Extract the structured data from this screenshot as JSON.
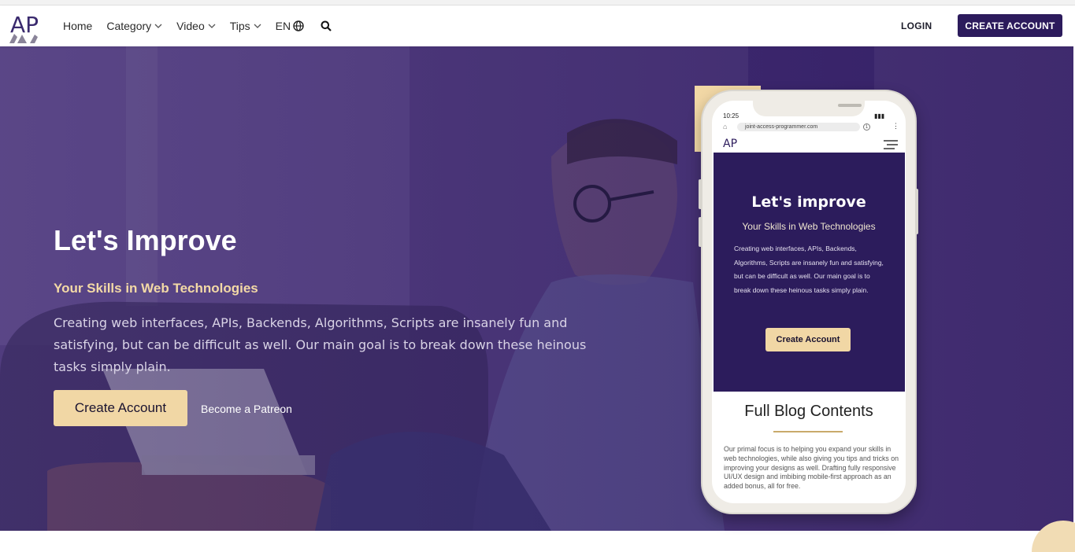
{
  "nav": {
    "logo_text": "AP",
    "links": [
      "Home",
      "Category",
      "Video",
      "Tips",
      "EN"
    ],
    "login": "LOGIN",
    "create_account": "CREATE ACCOUNT"
  },
  "hero": {
    "title": "Let's Improve",
    "subtitle": "Your Skills in Web Technologies",
    "text": "Creating web interfaces, APIs, Backends, Algorithms, Scripts are insanely fun and satisfying, but can be difficult as well. Our main goal is to break down these heinous tasks simply plain.",
    "button": "Create Account",
    "patreon": "Become a Patreon"
  },
  "phone": {
    "time": "10:25",
    "url": "joint-access-programmer.com",
    "tabs_count": "1",
    "logo_text": "AP",
    "title": "Let's improve",
    "subtitle": "Your Skills in Web Technologies",
    "text": "Creating web interfaces, APIs, Backends, Algorithms, Scripts are insanely fun and satisfying, but can be difficult as well. Our main goal is to break down these heinous tasks simply plain.",
    "button": "Create Account",
    "blog_title": "Full Blog Contents",
    "blog_text": "Our primal focus is to helping you expand your skills in web technologies, while also giving you tips and tricks on improving your designs as well. Drafting fully responsive UI/UX design and imbibing mobile-first approach as an added bonus, all for free."
  },
  "colors": {
    "brand": "#2c1b5c",
    "accent": "#f1d7a5",
    "hero_subtitle": "#f3d9a6"
  }
}
